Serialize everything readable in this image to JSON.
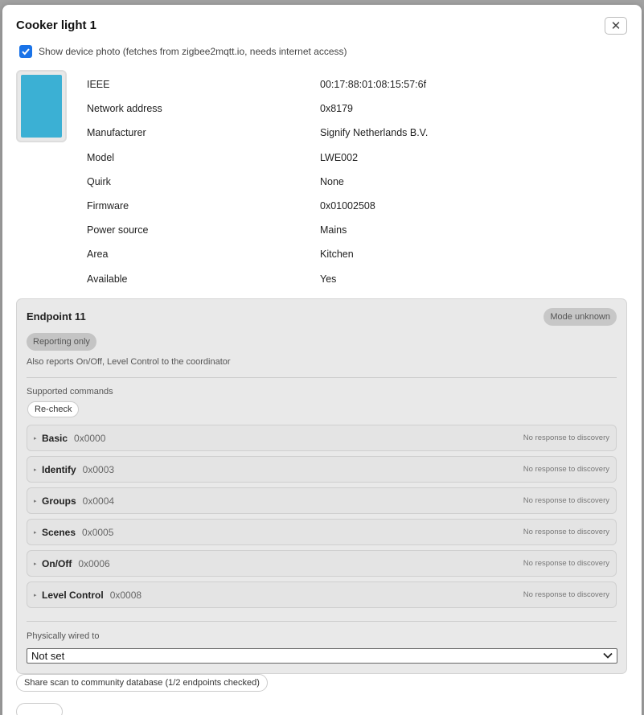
{
  "dialog": {
    "title": "Cooker light 1",
    "close_icon": "close-icon"
  },
  "photo_option": {
    "label": "Show device photo (fetches from zigbee2mqtt.io, needs internet access)",
    "checked": true
  },
  "device_info": [
    {
      "key": "IEEE",
      "value": "00:17:88:01:08:15:57:6f"
    },
    {
      "key": "Network address",
      "value": "0x8179"
    },
    {
      "key": "Manufacturer",
      "value": "Signify Netherlands B.V."
    },
    {
      "key": "Model",
      "value": "LWE002"
    },
    {
      "key": "Quirk",
      "value": "None"
    },
    {
      "key": "Firmware",
      "value": "0x01002508"
    },
    {
      "key": "Power source",
      "value": "Mains"
    },
    {
      "key": "Area",
      "value": "Kitchen"
    },
    {
      "key": "Available",
      "value": "Yes"
    }
  ],
  "endpoint": {
    "title": "Endpoint 11",
    "mode_badge": "Mode unknown",
    "reporting_badge": "Reporting only",
    "reports_text": "Also reports On/Off, Level Control to the coordinator",
    "supported_label": "Supported commands",
    "recheck_label": "Re-check",
    "clusters": [
      {
        "name": "Basic",
        "code": "0x0000",
        "status": "No response to discovery"
      },
      {
        "name": "Identify",
        "code": "0x0003",
        "status": "No response to discovery"
      },
      {
        "name": "Groups",
        "code": "0x0004",
        "status": "No response to discovery"
      },
      {
        "name": "Scenes",
        "code": "0x0005",
        "status": "No response to discovery"
      },
      {
        "name": "On/Off",
        "code": "0x0006",
        "status": "No response to discovery"
      },
      {
        "name": "Level Control",
        "code": "0x0008",
        "status": "No response to discovery"
      }
    ],
    "wired_label": "Physically wired to",
    "wired_value": "Not set"
  },
  "share_button": "Share scan to community database (1/2 endpoints checked)",
  "colors": {
    "accent": "#1a73e8",
    "photo": "#3bb0d4"
  }
}
